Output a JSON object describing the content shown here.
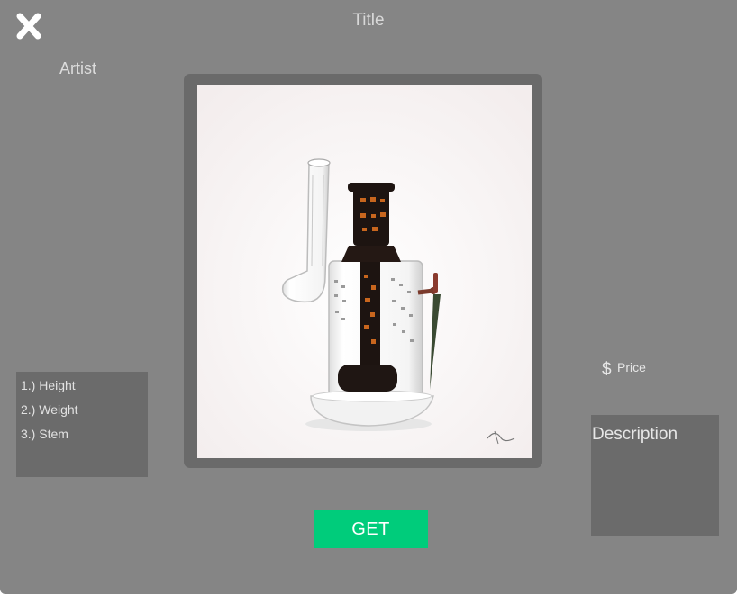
{
  "modal": {
    "title": "Title",
    "artist": "Artist",
    "close_icon": "close-x-icon"
  },
  "product": {
    "image_subject": "glass water pipe with dagger accent",
    "specs": [
      {
        "label": "1.) Height"
      },
      {
        "label": "2.) Weight"
      },
      {
        "label": "3.) Stem"
      }
    ],
    "price_symbol": "$",
    "price_label": "Price",
    "description_label": "Description"
  },
  "actions": {
    "get_label": "GET"
  },
  "colors": {
    "background": "#858585",
    "panel": "#6b6b6b",
    "accent": "#00cc7b",
    "text": "#e2e2e2"
  }
}
